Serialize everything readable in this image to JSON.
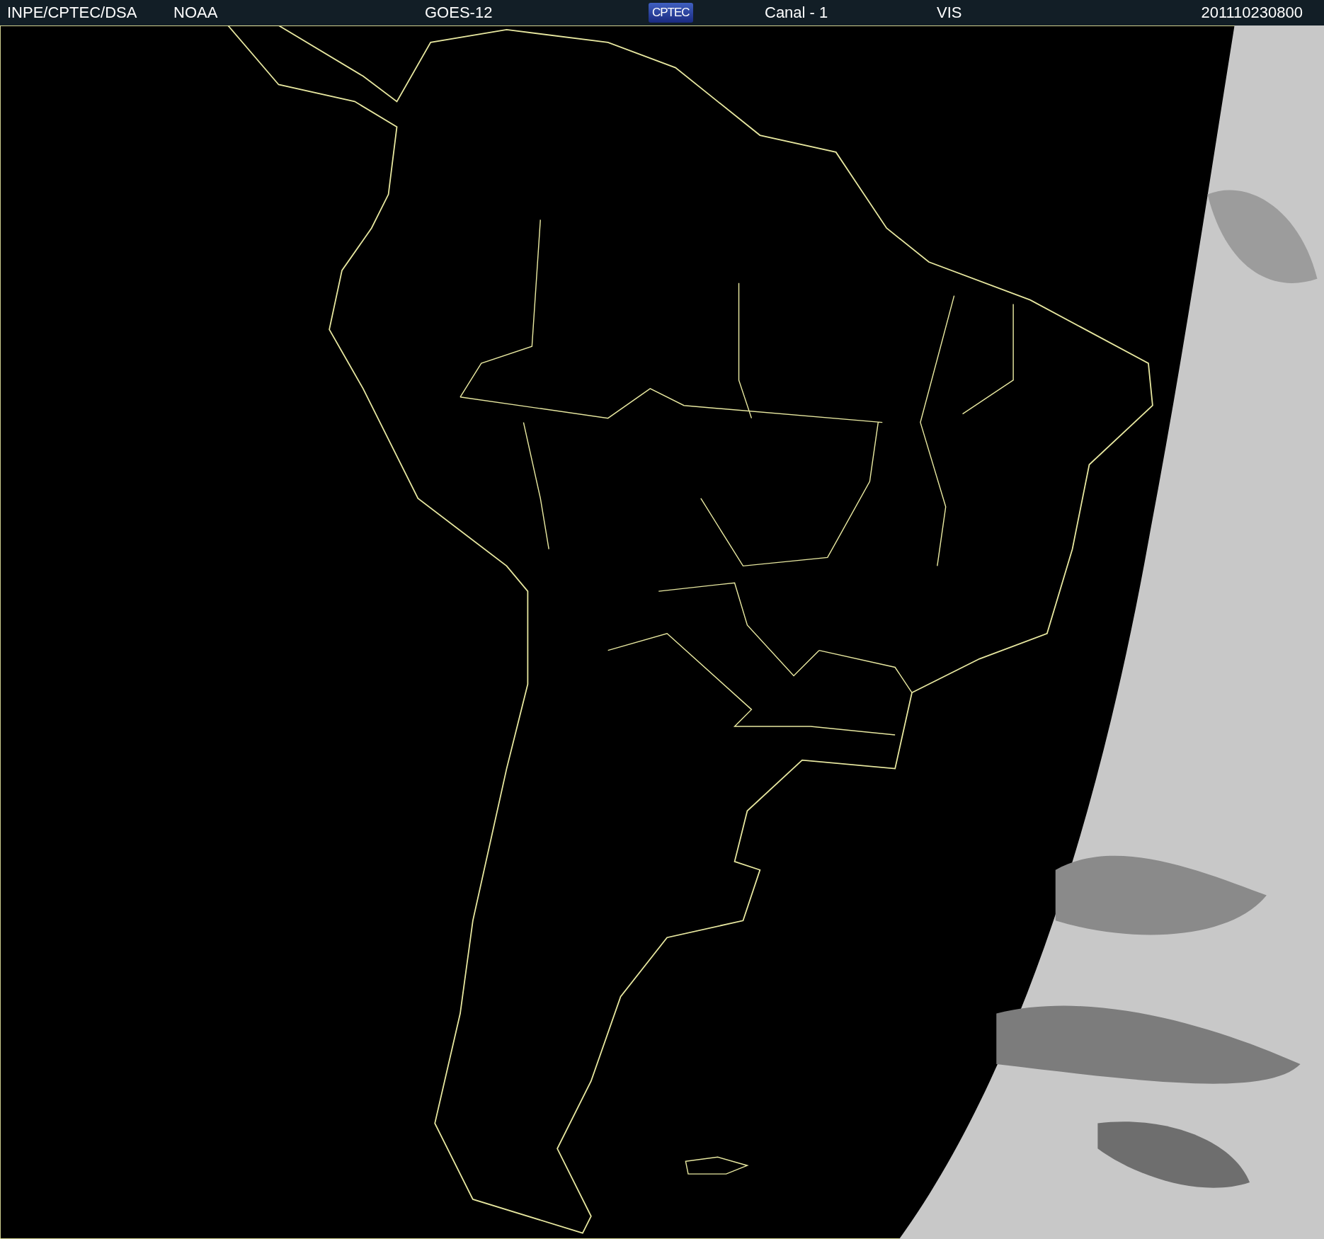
{
  "header": {
    "source": "INPE/CPTEC/DSA",
    "agency": "NOAA",
    "satellite": "GOES-12",
    "logo_text": "CPTEC",
    "channel": "Canal - 1",
    "band": "VIS",
    "timestamp": "201110230800"
  }
}
